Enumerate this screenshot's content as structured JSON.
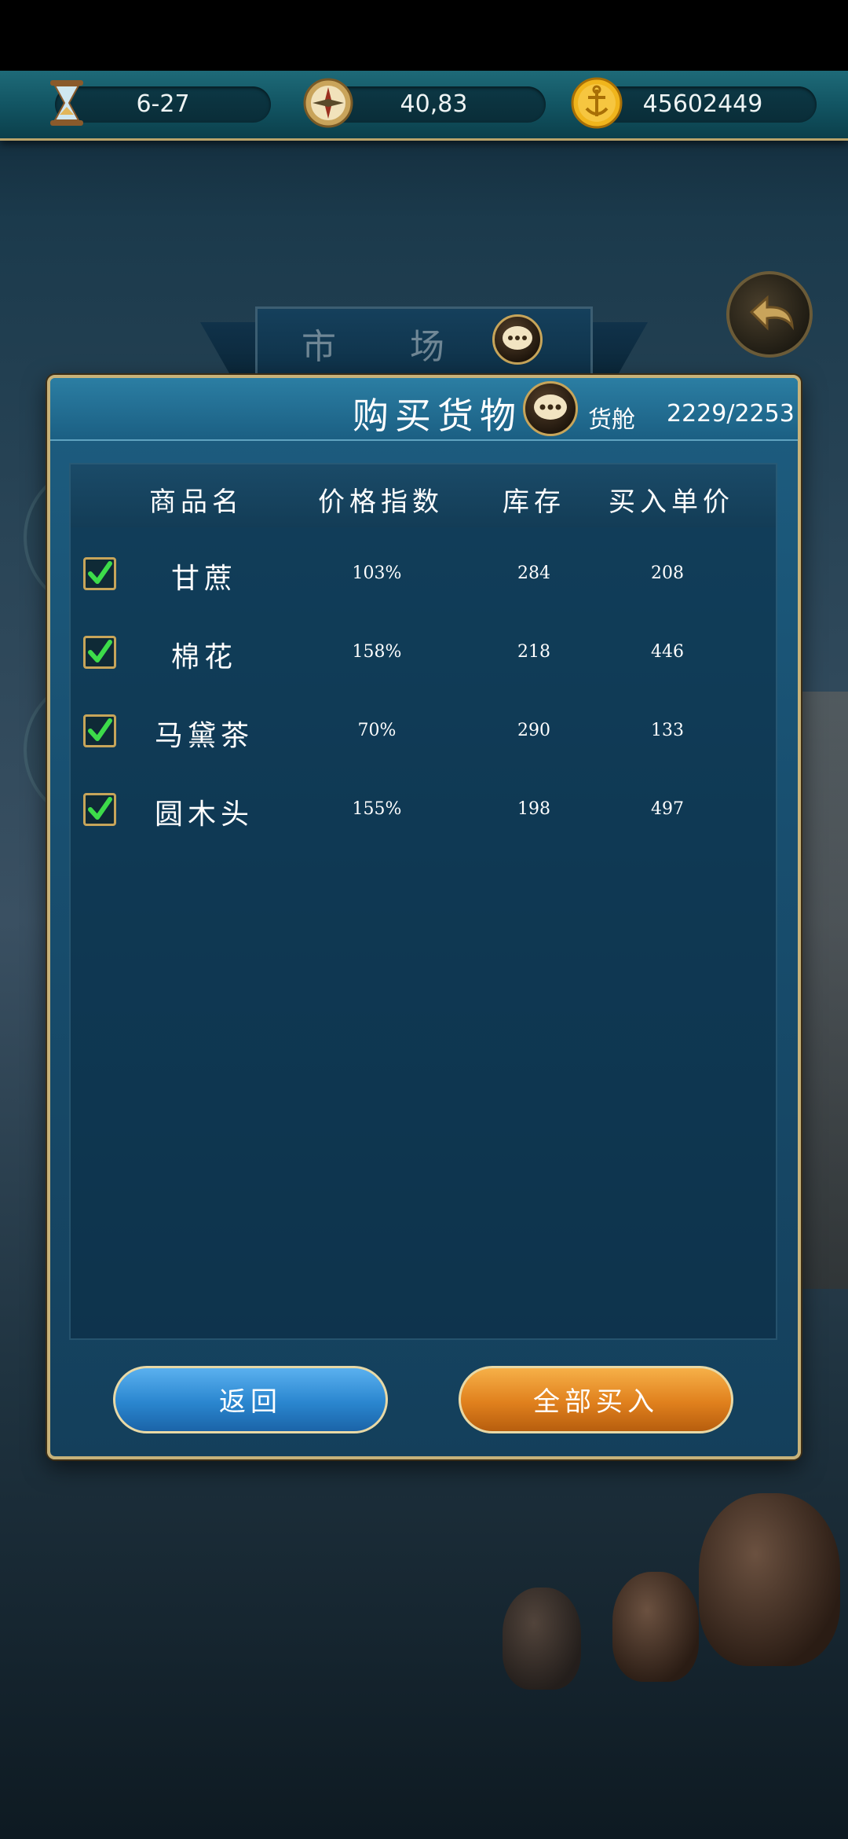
{
  "status_bar": {
    "date": "6-27",
    "coordinates": "40,83",
    "gold": "45602449",
    "icons": [
      "hourglass-icon",
      "compass-icon",
      "gold-coin-icon"
    ]
  },
  "market": {
    "title": "市 场"
  },
  "panel": {
    "title": "购买货物",
    "capacity_label": "货舱",
    "capacity_value": "2229/2253"
  },
  "table": {
    "headers": [
      "商品名",
      "价格指数",
      "库存",
      "买入单价"
    ],
    "rows": [
      {
        "checked": true,
        "name": "甘蔗",
        "price_index": "103%",
        "stock": "284",
        "unit_price": "208"
      },
      {
        "checked": true,
        "name": "棉花",
        "price_index": "158%",
        "stock": "218",
        "unit_price": "446"
      },
      {
        "checked": true,
        "name": "马黛茶",
        "price_index": "70%",
        "stock": "290",
        "unit_price": "133"
      },
      {
        "checked": true,
        "name": "圆木头",
        "price_index": "155%",
        "stock": "198",
        "unit_price": "497"
      }
    ]
  },
  "buttons": {
    "back": "返回",
    "buy_all": "全部买入"
  },
  "colors": {
    "panel_border": "#c7b27a",
    "panel_bg": "#184f70",
    "check_green": "#3ddc4a",
    "back_button": "#2a86cf",
    "buy_all_button": "#e0801d"
  }
}
